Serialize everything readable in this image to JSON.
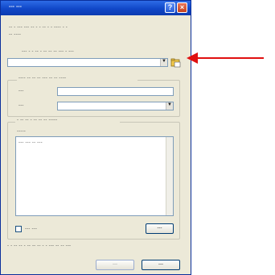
{
  "window": {
    "title": "--- ---",
    "help_glyph": "?",
    "close_glyph": "×"
  },
  "intro": {
    "line1": "-- - --- --- -- - - -- - - ---- - -",
    "line2": "-- ----"
  },
  "combo_label": "--- - - -- - -- -- -- --- - ---",
  "combo_value": "",
  "combo_arrow": "▼",
  "group1": {
    "title": "---- -- -- -- --- -- -- ----",
    "row1_label": "---",
    "row2_label": "---"
  },
  "group2": {
    "title": "- -- -- - -- -- -- -----",
    "list_label": "-----",
    "list_item": "--- --- -- ---"
  },
  "checkbox_label": "--- ---",
  "add_button_label": "---",
  "bottom_text": "- - -- -- - -- -- -- - - --- -- -- ---",
  "ok_button_label": "---",
  "cancel_button_label": "---",
  "colors": {
    "titlebar": "#1047c8",
    "window_bg": "#ece9d8",
    "arrow": "#e01010"
  }
}
